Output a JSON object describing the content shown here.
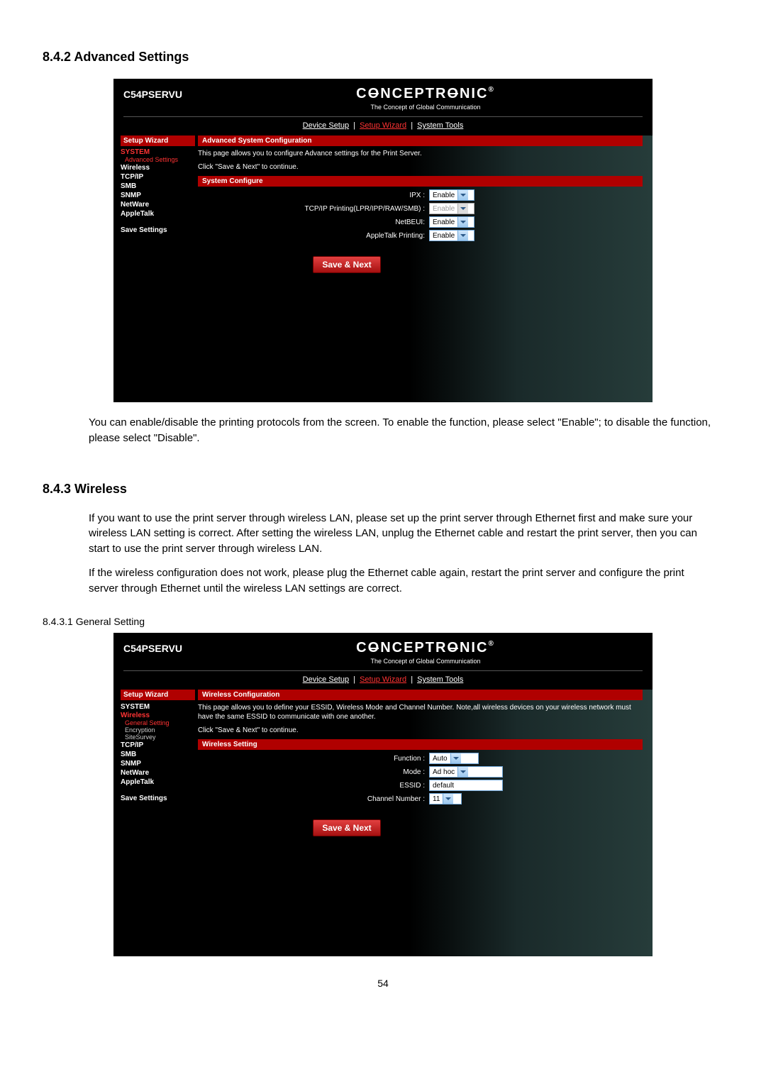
{
  "sections": {
    "s842": {
      "title": "8.4.2 Advanced Settings"
    },
    "s843": {
      "title": "8.4.3 Wireless"
    },
    "s8431": {
      "title": "8.4.3.1 General Setting"
    }
  },
  "text": {
    "advanced_p": "You can enable/disable the printing protocols from the screen. To enable the function, please select \"Enable\"; to disable the function, please select \"Disable\".",
    "wireless_p1": "If you want to use the print server through wireless LAN, please set up the print server through Ethernet first and make sure your wireless LAN setting is correct. After setting the wireless LAN, unplug the Ethernet cable and restart the print server, then you can start to use the print server through wireless LAN.",
    "wireless_p2": "If the wireless configuration does not work, please plug the Ethernet cable again, restart the print server and configure the print server through Ethernet until the wireless LAN settings are correct."
  },
  "shot": {
    "product": "C54PSERVU",
    "brand": "CONCEPTRONIC",
    "tagline": "The Concept of Global Communication",
    "tabs": {
      "device": "Device Setup",
      "wizard": "Setup Wizard",
      "tools": "System Tools"
    },
    "sidebar": {
      "hdr": "Setup Wizard",
      "system": "SYSTEM",
      "adv": "Advanced Settings",
      "wireless": "Wireless",
      "general": "General Setting",
      "enc": "Encryption",
      "survey": "SiteSurvey",
      "tcpip": "TCP/IP",
      "smb": "SMB",
      "snmp": "SNMP",
      "netware": "NetWare",
      "apple": "AppleTalk",
      "save": "Save Settings"
    }
  },
  "shot1": {
    "bar1": "Advanced System Configuration",
    "desc1": "This page allows you to configure Advance settings for the Print Server.",
    "desc2": "Click \"Save & Next\" to continue.",
    "bar2": "System Configure",
    "rows": {
      "ipx": "IPX :",
      "tcpip": "TCP/IP Printing(LPR/IPP/RAW/SMB) :",
      "netbeui": "NetBEUI:",
      "apple": "AppleTalk Printing:"
    },
    "enable": "Enable",
    "btn": "Save & Next"
  },
  "shot2": {
    "bar1": "Wireless Configuration",
    "desc1": "This page allows you to define your ESSID, Wireless Mode and Channel Number. Note,all wireless devices on your wireless network must have the same ESSID to communicate with one another.",
    "desc2": "Click \"Save & Next\" to continue.",
    "bar2": "Wireless Setting",
    "rows": {
      "func": "Function :",
      "mode": "Mode :",
      "essid": "ESSID :",
      "chan": "Channel Number :"
    },
    "vals": {
      "func": "Auto",
      "mode": "Ad hoc",
      "essid": "default",
      "chan": "11"
    },
    "btn": "Save & Next"
  },
  "pagenum": "54"
}
